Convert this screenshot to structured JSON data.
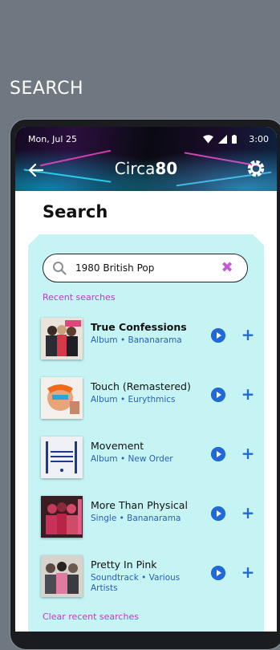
{
  "caption": "SEARCH",
  "status": {
    "date": "Mon, Jul 25",
    "time": "3:00"
  },
  "app": {
    "logo_main": "Circa",
    "logo_bold": "80"
  },
  "page": {
    "title": "Search"
  },
  "search": {
    "value": "1980 British Pop",
    "placeholder": ""
  },
  "labels": {
    "recent": "Recent searches",
    "clear": "Clear recent searches"
  },
  "results": [
    {
      "title": "True Confessions",
      "subtitle": "Album • Bananarama",
      "bold": true
    },
    {
      "title": "Touch (Remastered)",
      "subtitle": "Album • Eurythmics",
      "bold": false
    },
    {
      "title": "Movement",
      "subtitle": "Album • New Order",
      "bold": false
    },
    {
      "title": "More Than Physical",
      "subtitle": "Single • Bananarama",
      "bold": false
    },
    {
      "title": "Pretty In Pink",
      "subtitle": "Soundtrack • Various Artists",
      "bold": false
    }
  ],
  "cover_text": {
    "new_order": "NEW ORDER\nFACT 50 1981\nMOVEMENT"
  },
  "colors": {
    "accent_blue": "#1f6ad8",
    "accent_purple": "#b13fbf",
    "card_bg": "#c6f4f4"
  },
  "icons": [
    "back-arrow-icon",
    "gear-icon",
    "search-icon",
    "close-x-icon",
    "play-icon",
    "plus-icon"
  ]
}
